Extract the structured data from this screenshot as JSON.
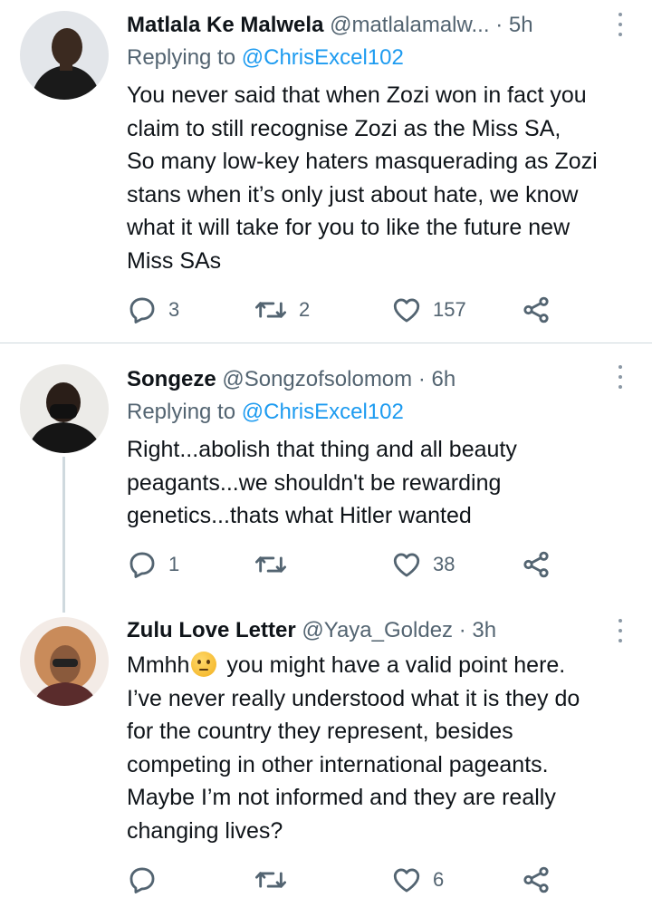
{
  "tweets": [
    {
      "name": "Matlala Ke Malwela",
      "handle": "@matlalamalw...",
      "separator": "·",
      "time": "5h",
      "replying_prefix": "Replying to ",
      "replying_to": "@ChrisExcel102",
      "text": "You never said that when Zozi won in fact you\nclaim to still recognise Zozi as the Miss SA,\nSo many low-key haters masquerading as Zozi\nstans when it’s only just about hate, we know\nwhat it will take for you to like the future new\nMiss SAs",
      "replies": "3",
      "retweets": "2",
      "likes": "157",
      "avatar_colors": [
        "#2b2b2b",
        "#d8dde4"
      ]
    },
    {
      "name": "Songeze",
      "handle": "@Songzofsolomom",
      "separator": "·",
      "time": "6h",
      "replying_prefix": "Replying to ",
      "replying_to": "@ChrisExcel102",
      "text": "Right...abolish that thing and all beauty\npeagants...we shouldn't be rewarding\ngenetics...thats what Hitler wanted",
      "replies": "1",
      "retweets": "",
      "likes": "38",
      "avatar_colors": [
        "#1c1c1c",
        "#e9e6e2"
      ]
    },
    {
      "name": "Zulu Love Letter",
      "handle": "@Yaya_Goldez",
      "separator": "·",
      "time": "3h",
      "text_first": "Mmhh",
      "emoji": "thinking-face",
      "text_rest": " you might have a valid point here.\nI’ve never really understood what it is they do\nfor the country they represent, besides\ncompeting in other international pageants.\nMaybe I’m not informed and they are really\nchanging lives?",
      "replies": "",
      "retweets": "",
      "likes": "6",
      "avatar_colors": [
        "#c98b5a",
        "#f1e6df"
      ]
    }
  ],
  "icons": {
    "reply": "reply-icon",
    "retweet": "retweet-icon",
    "like": "heart-icon",
    "share": "share-icon",
    "more": "more-icon"
  },
  "colors": {
    "text": "#0f1419",
    "muted": "#536471",
    "link": "#1d9bf0",
    "divider": "#cfd9de"
  }
}
